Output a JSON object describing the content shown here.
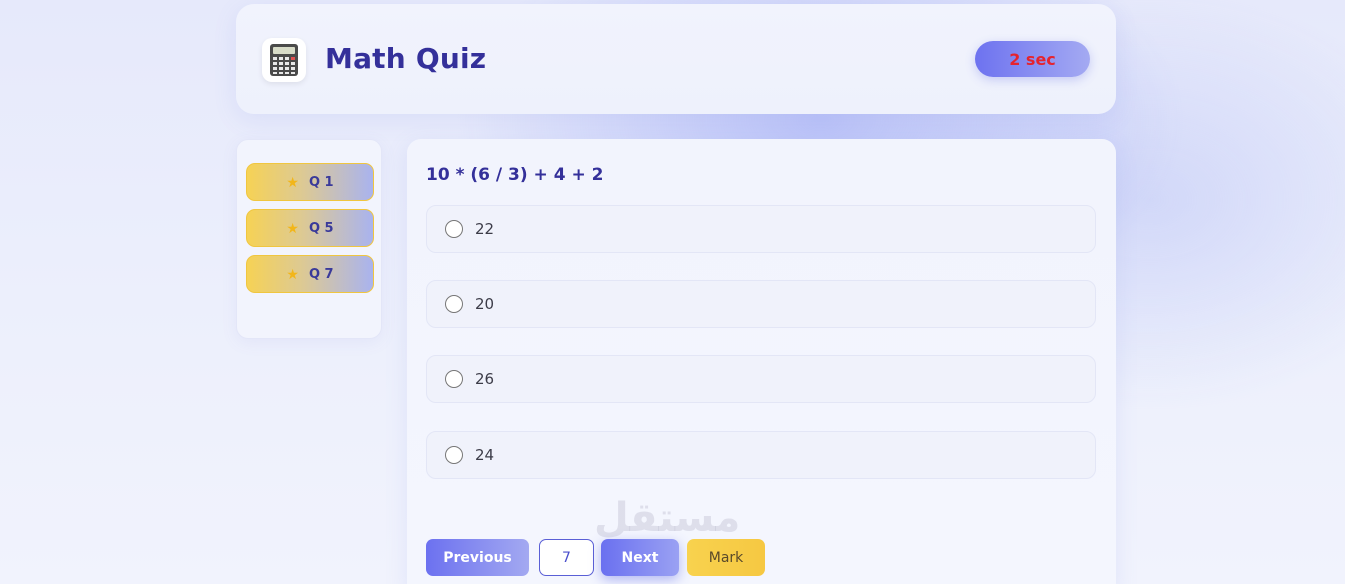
{
  "header": {
    "title": "Math Quiz",
    "timer": "2 sec",
    "logo_icon": "calculator-icon"
  },
  "sidebar": {
    "marked_items": [
      {
        "label": "Q 1",
        "icon": "star-icon"
      },
      {
        "label": "Q 5",
        "icon": "star-icon"
      },
      {
        "label": "Q 7",
        "icon": "star-icon"
      }
    ]
  },
  "question": {
    "text": "10 * (6 / 3) + 4 + 2",
    "options": [
      "22",
      "20",
      "26",
      "24"
    ]
  },
  "controls": {
    "previous_label": "Previous",
    "current_number": "7",
    "next_label": "Next",
    "mark_label": "Mark"
  },
  "watermark": "مستقل",
  "colors": {
    "accent": "#6c71f0",
    "title": "#34309a",
    "timer_text": "#e5232e",
    "mark": "#f6c842"
  }
}
